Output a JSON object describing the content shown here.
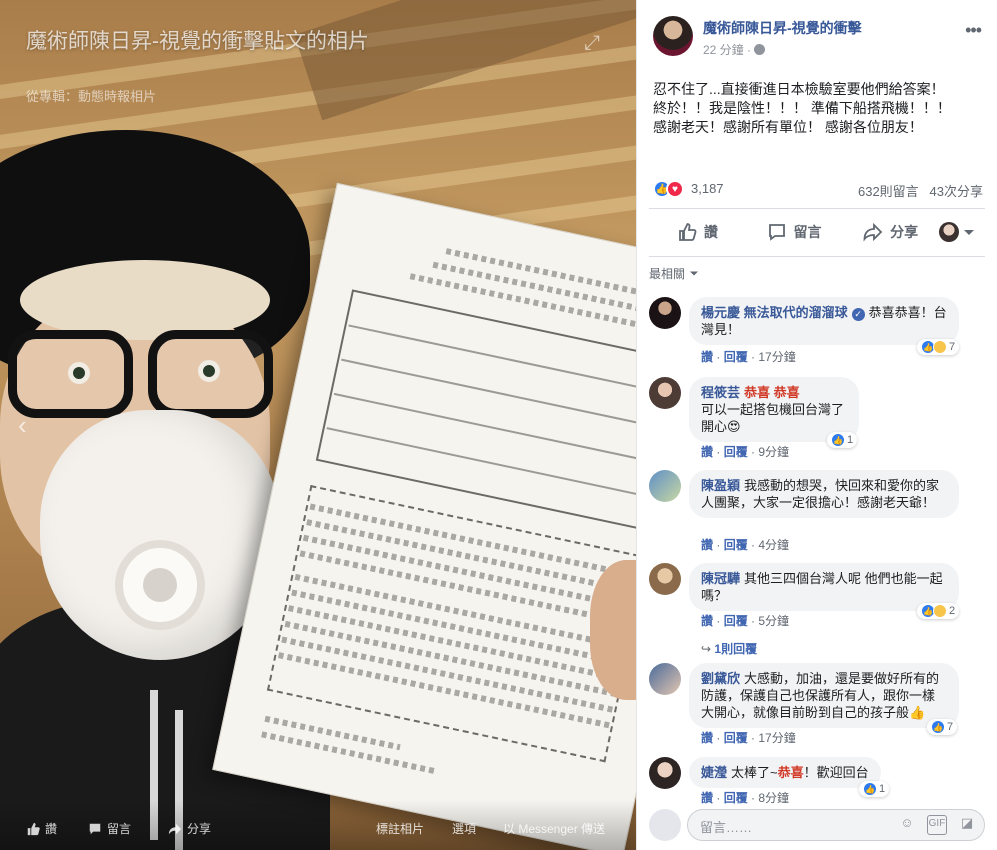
{
  "photo": {
    "title": "魔術師陳日昇-視覺的衝擊貼文的相片",
    "subtitle": "從專輯：動態時報相片",
    "bar": {
      "like": "讚",
      "comment": "留言",
      "share": "分享",
      "tag": "標註相片",
      "options": "選項",
      "messenger": "以 Messenger 傳送"
    }
  },
  "post": {
    "page_name": "魔術師陳日昇-視覺的衝擊",
    "time": "22 分鐘",
    "body": "忍不住了...直接衝進日本檢驗室要他們給答案！\n終於！！我是陰性！！！ 準備下船搭飛機！！！\n感謝老天！感謝所有單位！ 感謝各位朋友！",
    "reaction_count": "3,187",
    "comment_count": "632則留言",
    "share_count": "43次分享"
  },
  "actions": {
    "like": "讚",
    "comment": "留言",
    "share": "分享"
  },
  "sort": {
    "label": "最相關"
  },
  "comments": [
    {
      "name": "楊元慶 無法取代的溜溜球",
      "verified": true,
      "tag": "",
      "text": "恭喜恭喜！台灣見！",
      "reactions": "7",
      "like": "讚",
      "reply": "回覆",
      "time": "17分鐘"
    },
    {
      "name": "程筱芸",
      "verified": false,
      "tag": "恭喜 恭喜",
      "text": "可以一起搭包機回台灣了 開心😍",
      "reactions": "1",
      "like": "讚",
      "reply": "回覆",
      "time": "9分鐘"
    },
    {
      "name": "陳盈穎",
      "verified": false,
      "tag": "",
      "text": "我感動的想哭，快回來和愛你的家人團聚，大家一定很擔心！感謝老天爺！",
      "reactions": "",
      "like": "讚",
      "reply": "回覆",
      "time": "4分鐘"
    },
    {
      "name": "陳冠驊",
      "verified": false,
      "tag": "",
      "text": "其他三四個台灣人呢 他們也能一起嗎？",
      "reactions": "2",
      "like": "讚",
      "reply": "回覆",
      "time": "5分鐘",
      "replies": "1則回覆"
    },
    {
      "name": "劉黛欣",
      "verified": false,
      "tag": "",
      "text": "大感動，加油，還是要做好所有的防護，保護自己也保護所有人，跟你一樣大開心，就像目前盼到自己的孩子般👍",
      "reactions": "7",
      "like": "讚",
      "reply": "回覆",
      "time": "17分鐘"
    },
    {
      "name": "婕瀅",
      "verified": false,
      "tag": "",
      "text": "太棒了~",
      "tag2": "恭喜",
      "text2": "！歡迎回台",
      "reactions": "1",
      "like": "讚",
      "reply": "回覆",
      "time": "8分鐘"
    }
  ],
  "comment_box": {
    "placeholder": "留言……"
  },
  "icons": [
    "expand-icon",
    "globe-icon",
    "more-icon",
    "like-icon",
    "comment-icon",
    "share-icon",
    "emoji-icon",
    "gif-icon",
    "sticker-icon"
  ],
  "colors": {
    "link": "#385898",
    "accent": "#4267b2",
    "tag": "#d13a27"
  }
}
